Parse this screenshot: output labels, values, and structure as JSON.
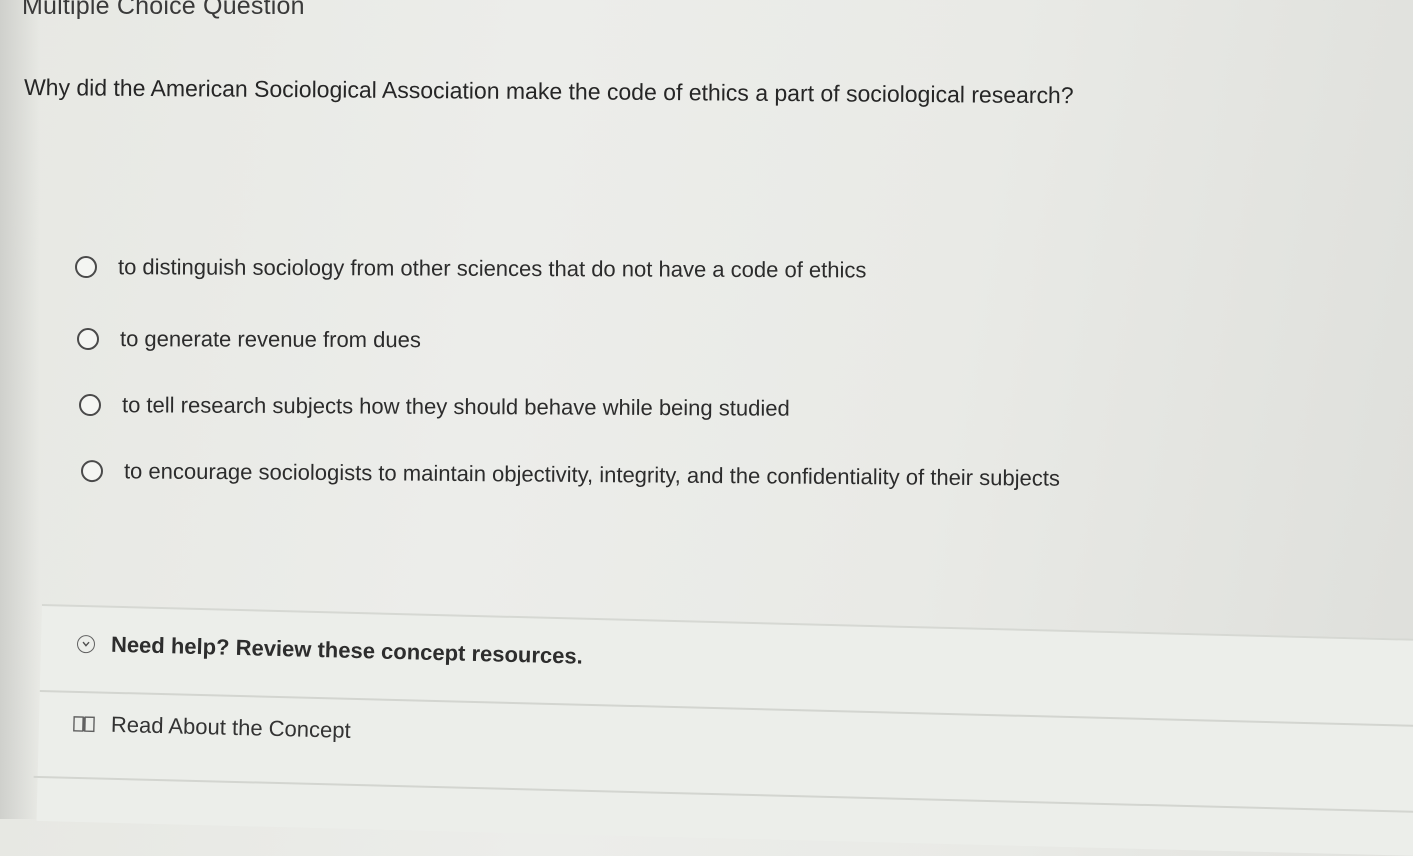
{
  "header": {
    "title": "Multiple Choice Question"
  },
  "question": {
    "text": "Why did the American Sociological Association make the code of ethics a part of sociological research?"
  },
  "options": [
    {
      "label": "to distinguish sociology from other sciences that do not have a code of ethics",
      "selected": false
    },
    {
      "label": "to generate revenue from dues",
      "selected": false
    },
    {
      "label": "to tell research subjects how they should behave while being studied",
      "selected": false
    },
    {
      "label": "to encourage sociologists to maintain objectivity, integrity, and the confidentiality of their subjects",
      "selected": false
    }
  ],
  "help": {
    "toggle_label": "Need help? Review these concept resources.",
    "toggle_icon": "chevron-down-circle-icon",
    "resources": [
      {
        "label": "Read About the Concept",
        "icon": "book-icon"
      }
    ]
  }
}
